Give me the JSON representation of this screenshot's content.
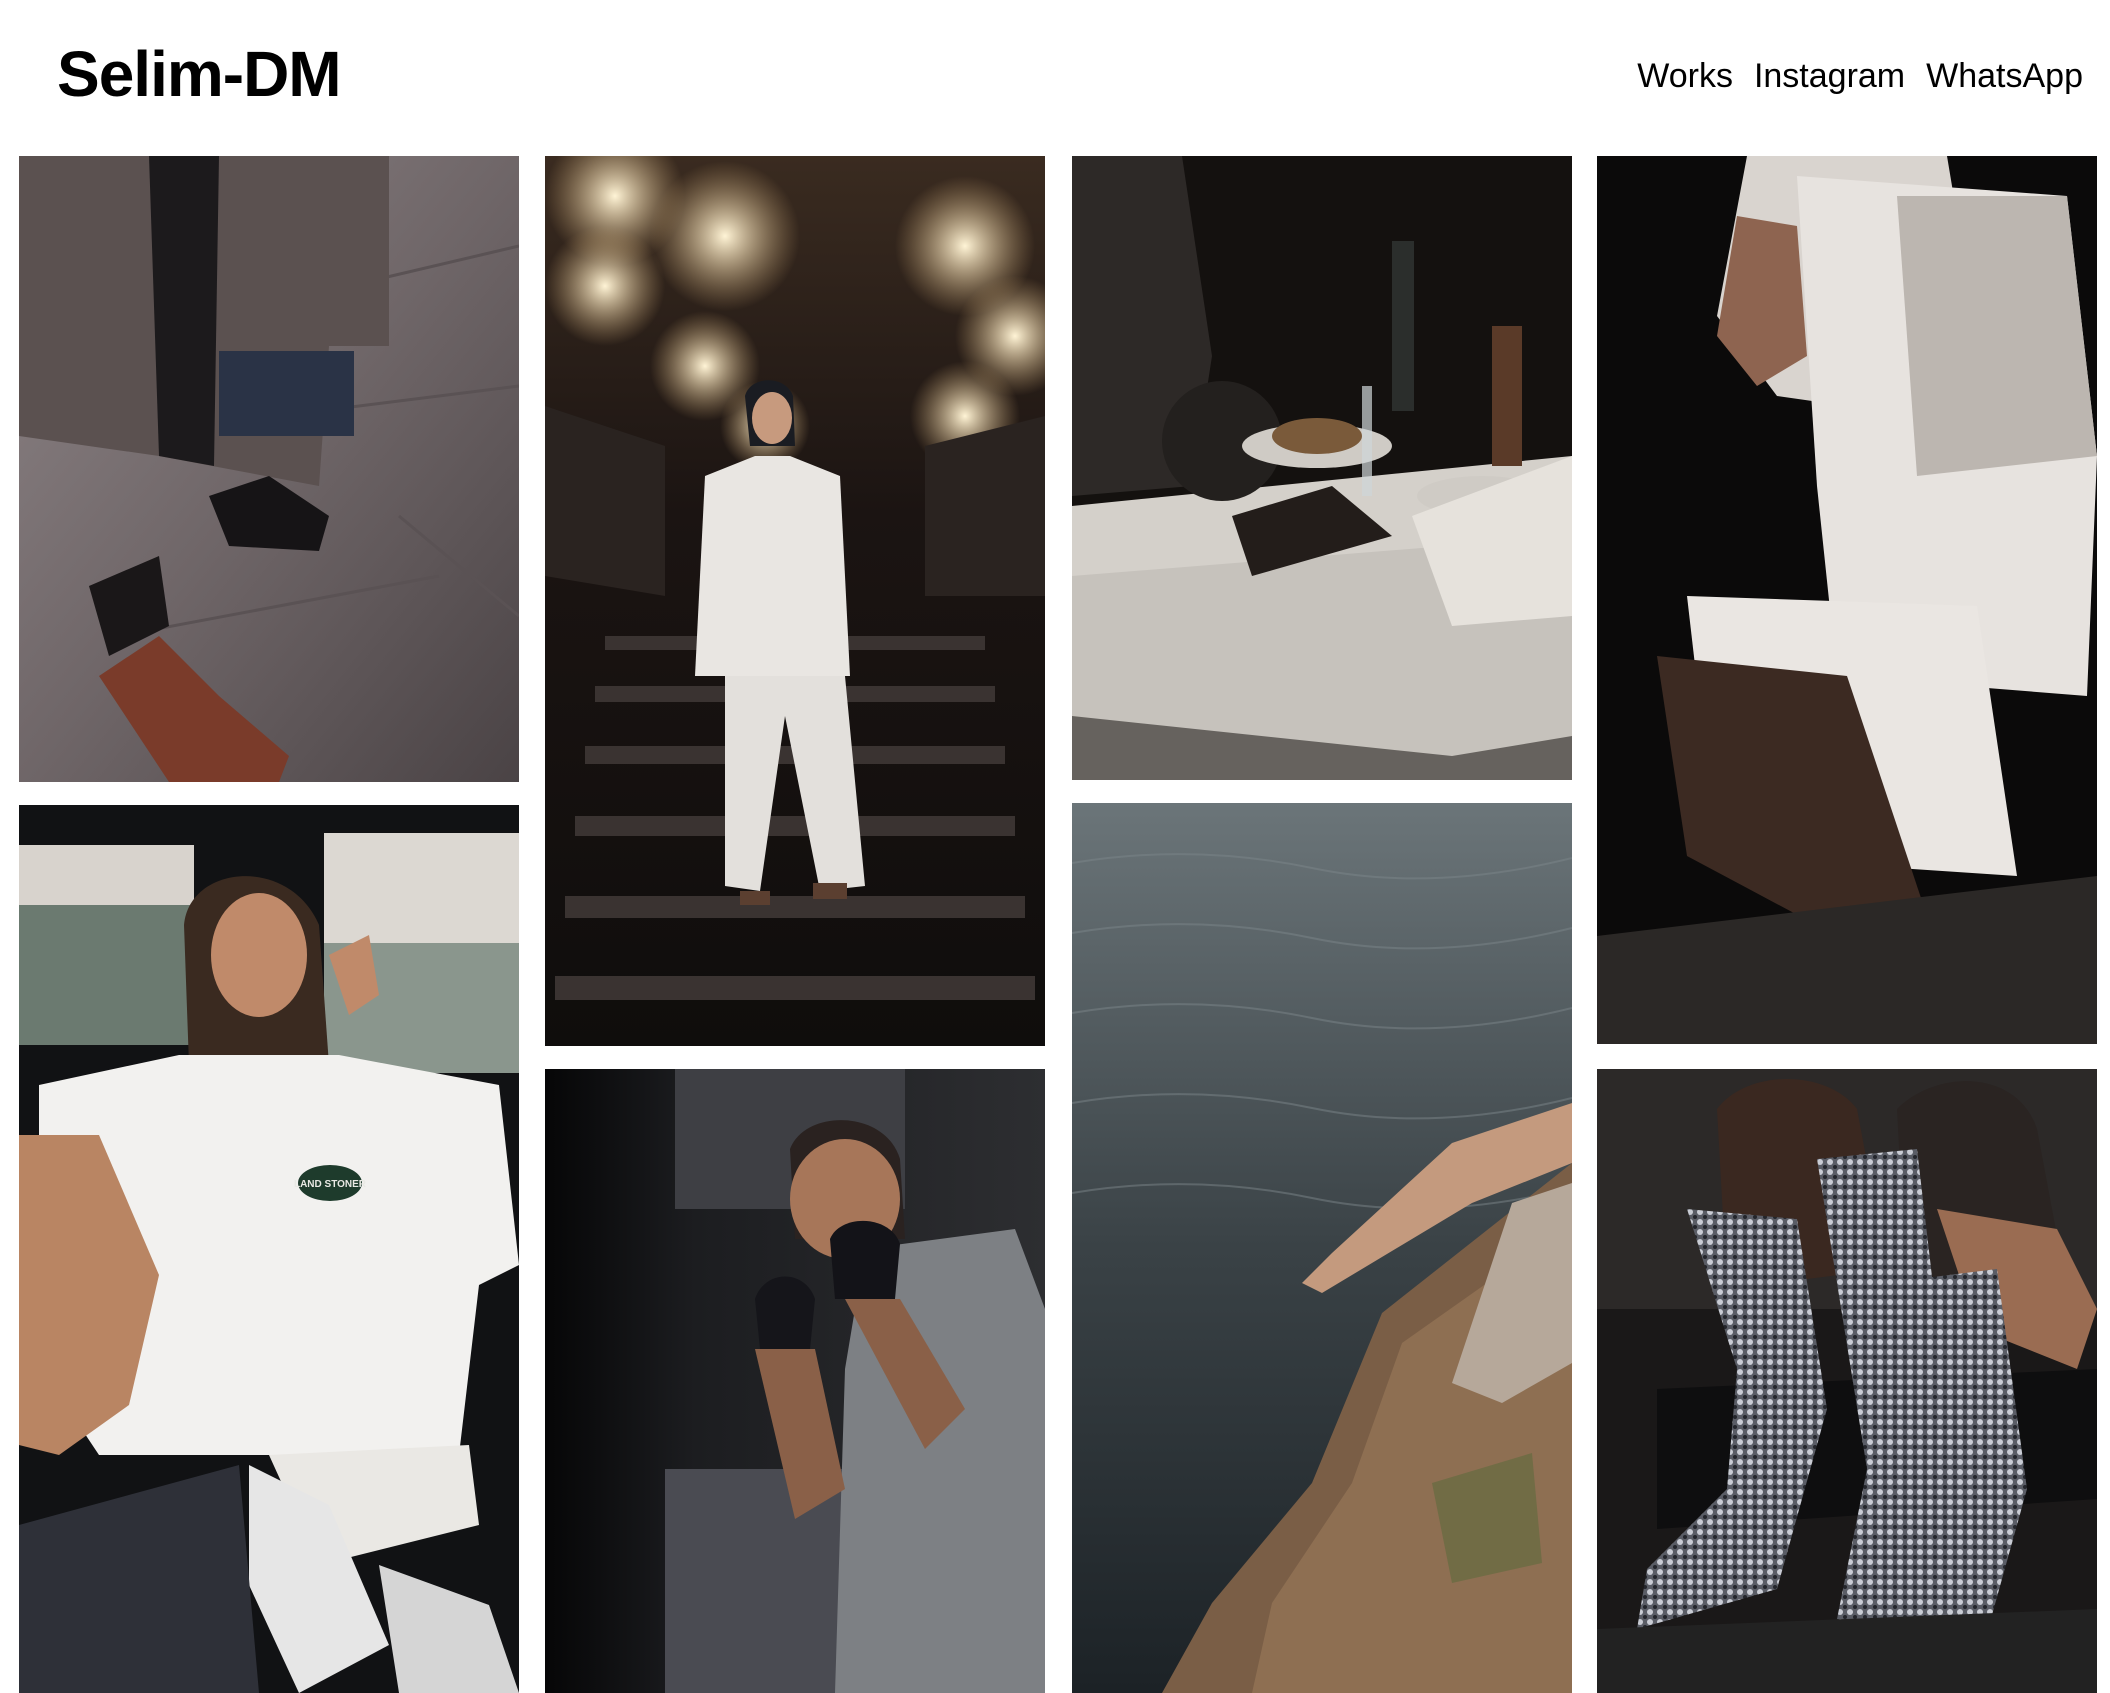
{
  "site": {
    "logo": "Selim-DM"
  },
  "nav": [
    {
      "label": "Works"
    },
    {
      "label": "Instagram"
    },
    {
      "label": "WhatsApp"
    }
  ],
  "photos": [
    {
      "subject": "shoes-on-wet-pavement"
    },
    {
      "subject": "woman-white-suit-chandelier-stairs"
    },
    {
      "subject": "dinner-table-dark-restaurant"
    },
    {
      "subject": "woman-white-outfit-shadows"
    },
    {
      "subject": "woman-in-car-white-tshirt",
      "shirt_badge": "LAND STONER"
    },
    {
      "subject": "boxer-gray-shirt"
    },
    {
      "subject": "hand-reaching-water-rocks"
    },
    {
      "subject": "sequined-boots-dark"
    }
  ]
}
